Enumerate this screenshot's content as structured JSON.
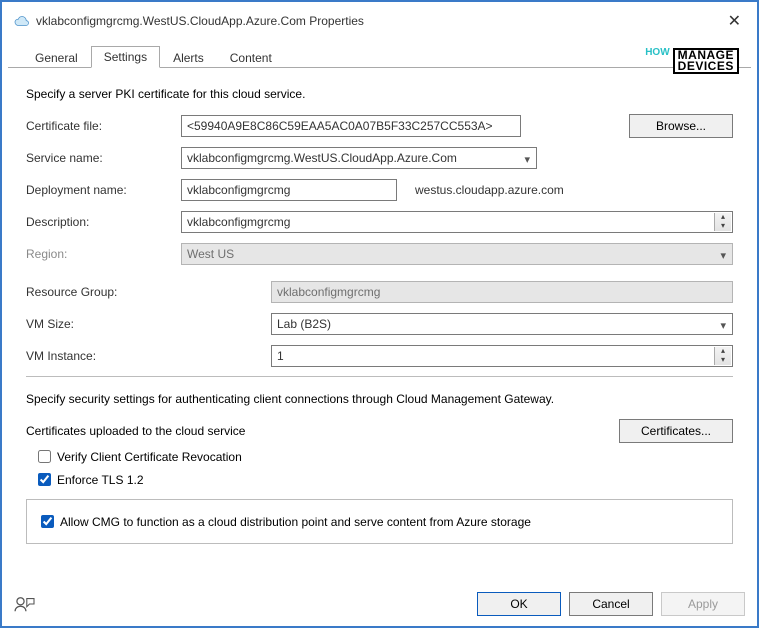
{
  "window": {
    "title": "vklabconfigmgrcmg.WestUS.CloudApp.Azure.Com Properties"
  },
  "tabs": [
    "General",
    "Settings",
    "Alerts",
    "Content"
  ],
  "active_tab": "Settings",
  "settings": {
    "intro": "Specify a server PKI certificate for this cloud service.",
    "cert_label": "Certificate file:",
    "cert_value": "<59940A9E8C86C59EAA5AC0A07B5F33C257CC553A>",
    "browse": "Browse...",
    "svc_label": "Service name:",
    "svc_value": "vklabconfigmgrcmg.WestUS.CloudApp.Azure.Com",
    "dep_label": "Deployment name:",
    "dep_value": "vklabconfigmgrcmg",
    "dep_suffix": "westus.cloudapp.azure.com",
    "desc_label": "Description:",
    "desc_value": "vklabconfigmgrcmg",
    "region_label": "Region:",
    "region_value": "West US",
    "rg_label": "Resource Group:",
    "rg_value": "vklabconfigmgrcmg",
    "vmsize_label": "VM Size:",
    "vmsize_value": "Lab (B2S)",
    "vminst_label": "VM Instance:",
    "vminst_value": "1",
    "security_intro": "Specify security settings for authenticating client connections through Cloud Management Gateway.",
    "certs_uploaded": "Certificates uploaded to the cloud service",
    "certs_btn": "Certificates...",
    "chk_revocation": "Verify Client Certificate Revocation",
    "chk_tls": "Enforce TLS 1.2",
    "chk_cdp": "Allow CMG to function as a cloud distribution point and serve content from Azure storage"
  },
  "buttons": {
    "ok": "OK",
    "cancel": "Cancel",
    "apply": "Apply"
  },
  "watermark": {
    "how": "HOW",
    "line1": "MANAGE",
    "line2": "DEVICES"
  }
}
